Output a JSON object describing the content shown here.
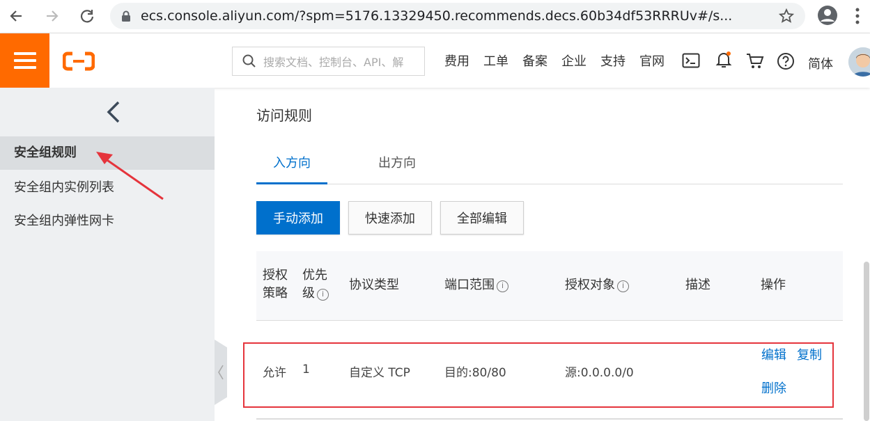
{
  "browser": {
    "url": "ecs.console.aliyun.com/?spm=5176.13329450.recommends.decs.60b34df53RRRUv#/s..."
  },
  "header": {
    "search_placeholder": "搜索文档、控制台、API、解",
    "nav": [
      "费用",
      "工单",
      "备案",
      "企业",
      "支持",
      "官网"
    ],
    "language": "简体",
    "brand_color": "#ff6a00"
  },
  "sidebar": {
    "items": [
      {
        "label": "安全组规则",
        "active": true
      },
      {
        "label": "安全组内实例列表",
        "active": false
      },
      {
        "label": "安全组内弹性网卡",
        "active": false
      }
    ]
  },
  "main": {
    "section_title": "访问规则",
    "tabs": [
      {
        "label": "入方向",
        "active": true
      },
      {
        "label": "出方向",
        "active": false
      }
    ],
    "buttons": {
      "manual_add": "手动添加",
      "quick_add": "快速添加",
      "edit_all": "全部编辑"
    },
    "table": {
      "headers": {
        "policy_line1": "授权",
        "policy_line2": "策略",
        "priority_line1": "优先",
        "priority_line2": "级",
        "protocol": "协议类型",
        "port_range": "端口范围",
        "auth_object": "授权对象",
        "description": "描述",
        "actions": "操作"
      },
      "rows": [
        {
          "policy": "允许",
          "priority": "1",
          "protocol": "自定义 TCP",
          "port_range": "目的:80/80",
          "auth_object": "源:0.0.0.0/0",
          "description": "",
          "actions": {
            "edit": "编辑",
            "copy": "复制",
            "delete": "删除"
          }
        }
      ]
    }
  },
  "colors": {
    "accent": "#0070cc",
    "highlight_border": "#e5343c"
  }
}
